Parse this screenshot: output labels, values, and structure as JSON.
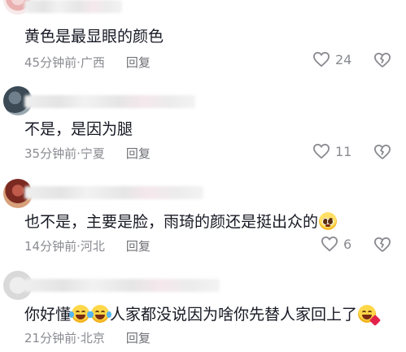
{
  "comments": [
    {
      "text": "黄色是最显眼的颜色",
      "time": "45分钟前",
      "location": "广西",
      "reply": "回复",
      "likes": "24"
    },
    {
      "text": "不是，是因为腿",
      "time": "35分钟前",
      "location": "宁夏",
      "reply": "回复",
      "likes": "11"
    },
    {
      "text": "也不是，主要是脸，雨琦的颜还是挺出众的",
      "time": "14分钟前",
      "location": "河北",
      "reply": "回复",
      "likes": "6"
    },
    {
      "text_a": "你好懂",
      "text_b": "人家都没说因为啥你先替人家回上了",
      "time": "21分钟前",
      "location": "北京",
      "reply": "回复"
    }
  ],
  "separator": " · ",
  "icons": [
    "heart-outline-icon",
    "dislike-heart-icon",
    "laughing-tears-emoji",
    "pleading-face-emoji",
    "hugging-face-emoji"
  ]
}
